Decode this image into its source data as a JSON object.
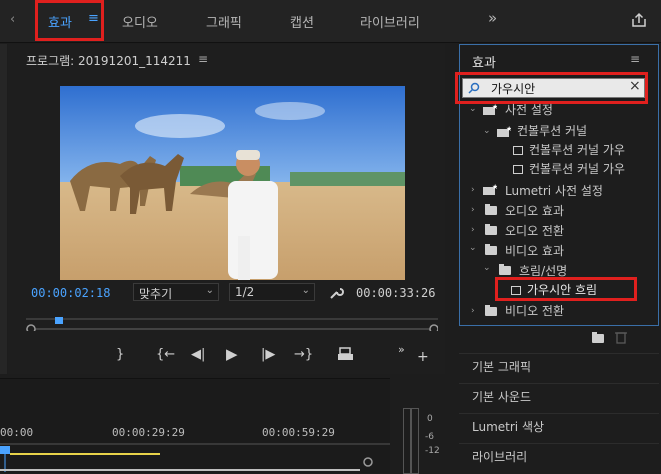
{
  "workspaces": {
    "effects": "효과",
    "effects_menu": "≡",
    "audio": "오디오",
    "graphics": "그래픽",
    "captions": "캡션",
    "libraries": "라이브러리",
    "more": "»"
  },
  "program": {
    "title": "프로그램: 20191201_114211",
    "title_menu": "≡",
    "current_time": "00:00:02:18",
    "fit": "맞추기",
    "resolution": "1/2",
    "duration": "00:00:33:26",
    "playhead_fraction": 0.07
  },
  "effects_panel": {
    "title": "효과",
    "menu": "≡",
    "search_value": "가우시안",
    "clear": "×",
    "tree": [
      {
        "label": "사전 설정"
      },
      {
        "label": "컨볼루션 커널"
      },
      {
        "label": "컨볼루션 커널 가우"
      },
      {
        "label": "컨볼루션 커널 가우"
      },
      {
        "label": "Lumetri 사전 설정"
      },
      {
        "label": "오디오 효과"
      },
      {
        "label": "오디오 전환"
      },
      {
        "label": "비디오 효과"
      },
      {
        "label": "흐림/선명"
      },
      {
        "label": "가우시안 흐림"
      },
      {
        "label": "비디오 전환"
      }
    ]
  },
  "lower_panels": [
    "기본 그래픽",
    "기본 사운드",
    "Lumetri 색상",
    "라이브러리"
  ],
  "timeline": {
    "times": [
      "00:00",
      "00:00:29:29",
      "00:00:59:29"
    ],
    "meter_labels": [
      "0",
      "-6",
      "-12"
    ]
  },
  "colors": {
    "accent": "#4aa3ff",
    "highlight_box": "#e0201e",
    "timecode": "#4aa3ff",
    "panel_border": "#3a6fa8"
  }
}
